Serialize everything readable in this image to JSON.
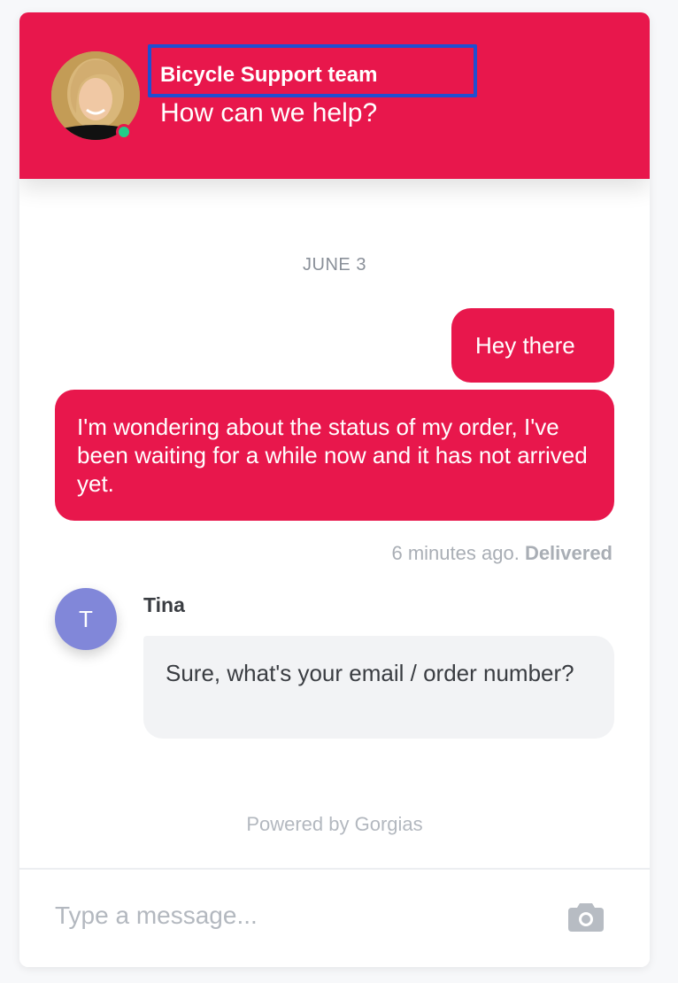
{
  "header": {
    "team_name": "Bicycle Support team",
    "subtitle": "How can we help?",
    "avatar_icon": "agent-photo",
    "status_indicator": "online",
    "accent_color": "#e8174c",
    "online_color": "#22cc88",
    "highlight_color": "#1f4fd1"
  },
  "conversation": {
    "date_label": "JUNE 3",
    "outgoing_messages": [
      {
        "text": "Hey there"
      },
      {
        "text": "I'm wondering about the status of my order, I've been waiting for a while now and it has not arrived yet."
      }
    ],
    "receipt": {
      "time": "6 minutes ago.",
      "status": "Delivered"
    },
    "agent": {
      "initial": "T",
      "name": "Tina",
      "avatar_color": "#8187d9",
      "message": "Sure, what's your email / order number?"
    }
  },
  "footer": {
    "powered_by": "Powered by Gorgias"
  },
  "composer": {
    "placeholder": "Type a message...",
    "value": "",
    "attach_icon": "camera-icon"
  }
}
